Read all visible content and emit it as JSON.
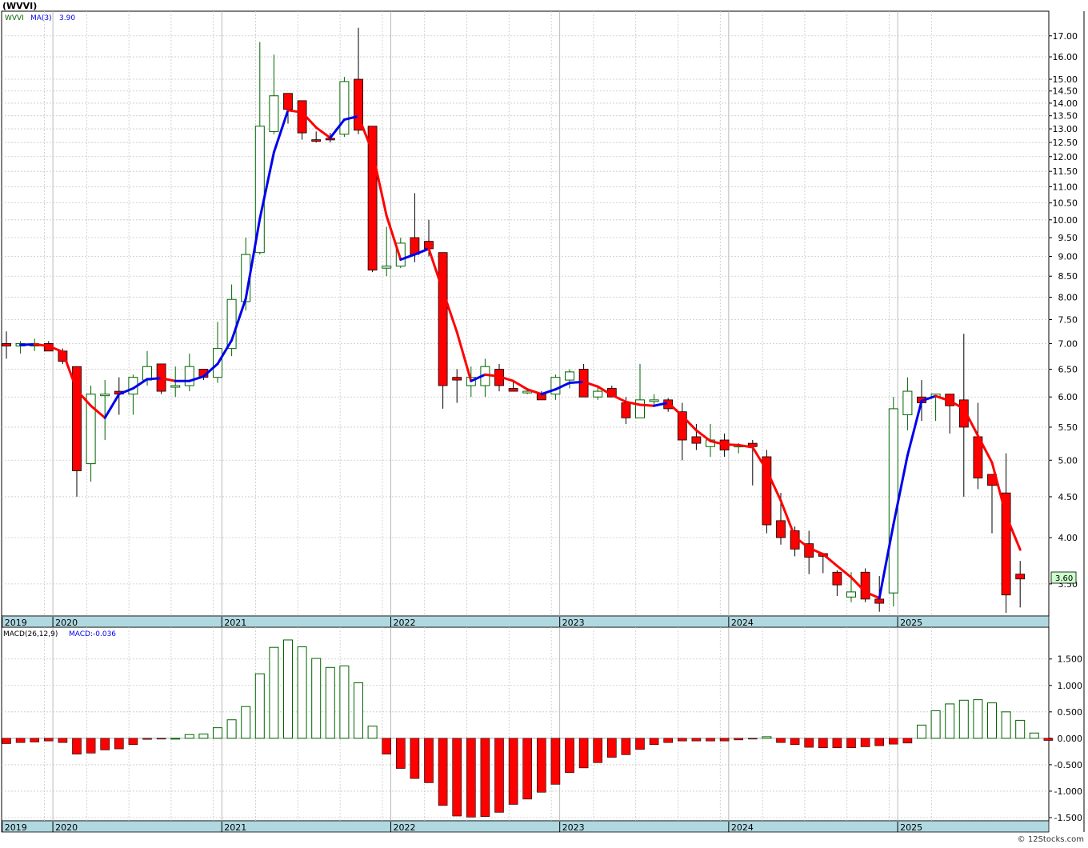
{
  "window": {
    "title": "(WVVI)"
  },
  "price_legend": {
    "symbol": "WVVI",
    "ma_label": "MA(3)",
    "ma_value": "3.90"
  },
  "macd_legend": {
    "label": "MACD(26,12,9)",
    "value_label": "MACD:-0.036"
  },
  "last_price_badge": "3.60",
  "watermark": "© 12Stocks.com",
  "colors": {
    "up": "#006400",
    "down": "#ff0000",
    "ma_up": "#0000ee",
    "ma_down": "#ff0000",
    "axis_band": "#b0d8e0",
    "grid": "#c8c8c8",
    "badge": "#ccffcc"
  },
  "chart_data": [
    {
      "type": "candlestick",
      "title": "(WVVI)",
      "y_scale": "log",
      "ylim": [
        3.25,
        18.0
      ],
      "grid": true,
      "y_ticks": [
        "17.00",
        "16.00",
        "15.00",
        "14.50",
        "14.00",
        "13.50",
        "13.00",
        "12.50",
        "12.00",
        "11.50",
        "11.00",
        "10.50",
        "10.00",
        "9.50",
        "9.00",
        "8.50",
        "8.00",
        "7.50",
        "7.00",
        "6.50",
        "6.00",
        "5.50",
        "5.00",
        "4.50",
        "4.00",
        "3.50"
      ],
      "x_labels": [
        {
          "label": "2019",
          "i": -0.3
        },
        {
          "label": "2020",
          "i": 3.3
        },
        {
          "label": "2021",
          "i": 15.3
        },
        {
          "label": "2022",
          "i": 27.3
        },
        {
          "label": "2023",
          "i": 39.3
        },
        {
          "label": "2024",
          "i": 51.3
        },
        {
          "label": "2025",
          "i": 63.3
        }
      ],
      "candles": [
        [
          7.0,
          7.25,
          6.7,
          6.95
        ],
        [
          6.95,
          7.05,
          6.8,
          7.0
        ],
        [
          6.95,
          7.1,
          6.85,
          7.0
        ],
        [
          7.0,
          7.05,
          6.85,
          6.85
        ],
        [
          6.85,
          6.9,
          6.6,
          6.65
        ],
        [
          6.55,
          6.55,
          4.5,
          4.85
        ],
        [
          4.95,
          6.2,
          4.7,
          6.05
        ],
        [
          6.05,
          6.3,
          5.3,
          6.05
        ],
        [
          6.1,
          6.35,
          5.7,
          6.05
        ],
        [
          6.05,
          6.4,
          5.7,
          6.35
        ],
        [
          6.3,
          6.85,
          6.2,
          6.55
        ],
        [
          6.6,
          6.6,
          6.05,
          6.1
        ],
        [
          6.2,
          6.55,
          6.0,
          6.2
        ],
        [
          6.2,
          6.8,
          6.1,
          6.55
        ],
        [
          6.5,
          6.5,
          6.3,
          6.35
        ],
        [
          6.35,
          7.45,
          6.25,
          6.9
        ],
        [
          6.9,
          8.3,
          6.75,
          7.95
        ],
        [
          7.9,
          9.5,
          7.7,
          9.05
        ],
        [
          9.1,
          16.7,
          9.05,
          13.1
        ],
        [
          12.9,
          16.1,
          12.8,
          14.3
        ],
        [
          14.4,
          14.4,
          13.2,
          13.75
        ],
        [
          14.1,
          14.1,
          12.6,
          12.85
        ],
        [
          12.6,
          12.9,
          12.5,
          12.55
        ],
        [
          12.65,
          12.85,
          12.5,
          12.6
        ],
        [
          12.8,
          15.1,
          12.7,
          14.9
        ],
        [
          15.0,
          17.4,
          12.8,
          12.95
        ],
        [
          13.1,
          13.1,
          8.6,
          8.65
        ],
        [
          8.7,
          9.8,
          8.5,
          8.75
        ],
        [
          8.75,
          9.5,
          8.7,
          9.35
        ],
        [
          9.5,
          10.8,
          8.85,
          9.05
        ],
        [
          9.4,
          10.0,
          9.0,
          9.2
        ],
        [
          9.1,
          9.1,
          5.8,
          6.2
        ],
        [
          6.35,
          6.5,
          5.9,
          6.3
        ],
        [
          6.2,
          6.55,
          6.0,
          6.35
        ],
        [
          6.2,
          6.7,
          6.0,
          6.55
        ],
        [
          6.5,
          6.6,
          6.1,
          6.2
        ],
        [
          6.15,
          6.3,
          6.1,
          6.1
        ],
        [
          6.1,
          6.15,
          6.05,
          6.1
        ],
        [
          6.05,
          6.1,
          5.95,
          5.95
        ],
        [
          6.05,
          6.4,
          5.95,
          6.35
        ],
        [
          6.3,
          6.5,
          6.15,
          6.45
        ],
        [
          6.5,
          6.6,
          6.0,
          6.0
        ],
        [
          6.0,
          6.2,
          5.95,
          6.1
        ],
        [
          6.15,
          6.2,
          6.0,
          6.0
        ],
        [
          5.9,
          6.0,
          5.55,
          5.65
        ],
        [
          5.65,
          6.6,
          5.65,
          5.95
        ],
        [
          5.95,
          6.05,
          5.85,
          5.95
        ],
        [
          5.95,
          5.98,
          5.75,
          5.8
        ],
        [
          5.75,
          5.9,
          5.0,
          5.3
        ],
        [
          5.35,
          5.55,
          5.15,
          5.25
        ],
        [
          5.2,
          5.55,
          5.05,
          5.3
        ],
        [
          5.3,
          5.4,
          5.05,
          5.15
        ],
        [
          5.2,
          5.25,
          5.1,
          5.22
        ],
        [
          5.25,
          5.3,
          4.65,
          5.2
        ],
        [
          5.05,
          5.15,
          4.05,
          4.15
        ],
        [
          4.2,
          4.55,
          3.92,
          4.0
        ],
        [
          4.08,
          4.13,
          3.79,
          3.87
        ],
        [
          3.93,
          4.08,
          3.6,
          3.78
        ],
        [
          3.82,
          3.83,
          3.61,
          3.79
        ],
        [
          3.62,
          3.64,
          3.38,
          3.49
        ],
        [
          3.37,
          3.62,
          3.32,
          3.42
        ],
        [
          3.62,
          3.66,
          3.32,
          3.35
        ],
        [
          3.35,
          3.58,
          3.23,
          3.31
        ],
        [
          3.41,
          6.0,
          3.28,
          5.8
        ],
        [
          5.7,
          6.35,
          5.45,
          6.1
        ],
        [
          6.0,
          6.3,
          5.6,
          5.9
        ],
        [
          6.0,
          6.05,
          5.6,
          6.05
        ],
        [
          6.05,
          6.05,
          5.4,
          5.85
        ],
        [
          5.95,
          7.2,
          4.5,
          5.5
        ],
        [
          5.35,
          5.9,
          4.6,
          4.75
        ],
        [
          4.8,
          4.8,
          4.05,
          4.65
        ],
        [
          4.55,
          5.1,
          3.22,
          3.39
        ],
        [
          3.6,
          3.74,
          3.27,
          3.55
        ]
      ],
      "ma_series": {
        "name": "MA(3)",
        "from_index": 1
      },
      "last_value": 3.6
    },
    {
      "type": "bar",
      "title": "MACD(26,12,9)",
      "ylim": [
        -1.5,
        1.95
      ],
      "grid": true,
      "y_ticks": [
        "1.500",
        "1.000",
        "0.500",
        "0.000",
        "-0.500",
        "-1.000",
        "-1.500"
      ],
      "x_labels": [
        {
          "label": "2019",
          "i": -0.3
        },
        {
          "label": "2020",
          "i": 3.3
        },
        {
          "label": "2021",
          "i": 15.3
        },
        {
          "label": "2022",
          "i": 27.3
        },
        {
          "label": "2023",
          "i": 39.3
        },
        {
          "label": "2024",
          "i": 51.3
        },
        {
          "label": "2025",
          "i": 63.3
        }
      ],
      "values": [
        -0.1,
        -0.08,
        -0.07,
        -0.05,
        -0.08,
        -0.3,
        -0.28,
        -0.22,
        -0.2,
        -0.12,
        -0.02,
        -0.01,
        0.0,
        0.07,
        0.08,
        0.2,
        0.35,
        0.6,
        1.22,
        1.72,
        1.86,
        1.73,
        1.51,
        1.34,
        1.37,
        1.05,
        0.23,
        -0.3,
        -0.57,
        -0.76,
        -0.84,
        -1.27,
        -1.47,
        -1.49,
        -1.48,
        -1.4,
        -1.25,
        -1.15,
        -1.02,
        -0.87,
        -0.65,
        -0.56,
        -0.46,
        -0.36,
        -0.31,
        -0.21,
        -0.12,
        -0.08,
        -0.05,
        -0.05,
        -0.05,
        -0.05,
        -0.03,
        -0.01,
        0.03,
        -0.08,
        -0.12,
        -0.17,
        -0.18,
        -0.18,
        -0.18,
        -0.16,
        -0.14,
        -0.11,
        -0.09,
        0.25,
        0.52,
        0.65,
        0.72,
        0.73,
        0.67,
        0.5,
        0.34,
        0.1,
        -0.04
      ]
    }
  ]
}
